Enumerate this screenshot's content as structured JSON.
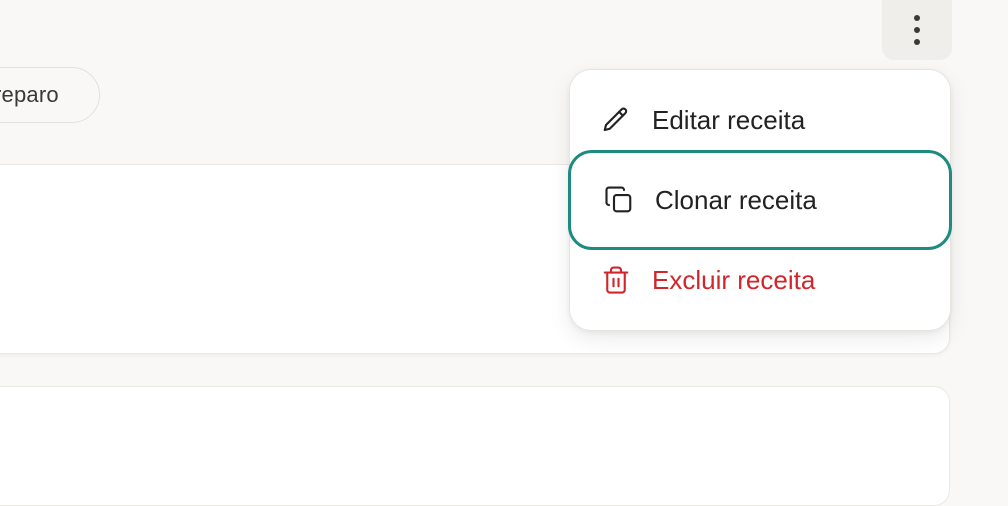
{
  "filter_chip": {
    "label": "reparo"
  },
  "more_button": {
    "icon": "more-vertical-icon"
  },
  "context_menu": {
    "items": [
      {
        "label": "Editar receita",
        "icon": "pencil-icon"
      },
      {
        "label": "Clonar receita",
        "icon": "copy-icon"
      },
      {
        "label": "Excluir receita",
        "icon": "trash-icon"
      }
    ]
  },
  "colors": {
    "background": "#f9f8f6",
    "focus_ring": "#1f8a80",
    "danger": "#d0262c",
    "text": "#222222"
  }
}
